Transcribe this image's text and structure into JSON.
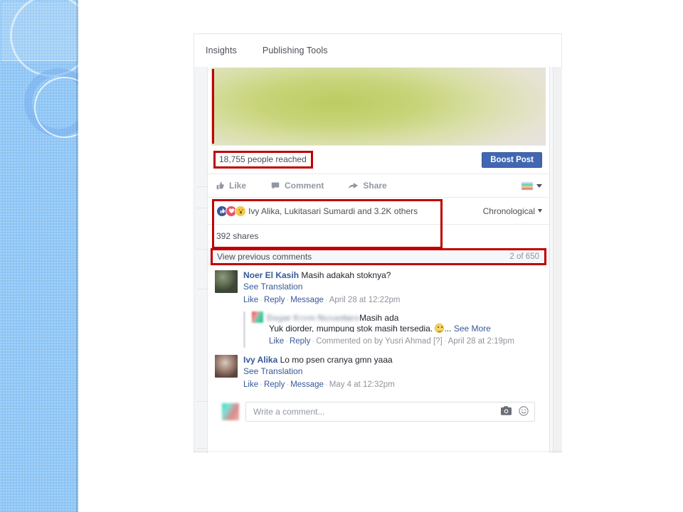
{
  "tabs": [
    {
      "label": "Insights"
    },
    {
      "label": "Publishing Tools"
    }
  ],
  "post": {
    "reach_text": "18,755 people reached",
    "boost_label": "Boost Post",
    "actions": [
      {
        "label": "Like",
        "icon": "thumbs-up-icon"
      },
      {
        "label": "Comment",
        "icon": "comment-bubble-icon"
      },
      {
        "label": "Share",
        "icon": "share-arrow-icon"
      }
    ],
    "audience_icon": "audience-thumbnail-icon",
    "reactions": {
      "icons": [
        "like-reaction-icon",
        "love-reaction-icon",
        "wow-reaction-icon"
      ],
      "summary": "Ivy Alika, Lukitasari Sumardi and 3.2K others"
    },
    "sort_label": "Chronological",
    "shares": "392 shares"
  },
  "comments_header": {
    "view_previous": "View previous comments",
    "count": "2 of 650"
  },
  "comments": [
    {
      "author": "Noer El Kasih",
      "text": "Masih adakah stoknya?",
      "translate": "See Translation",
      "actions": [
        "Like",
        "Reply",
        "Message"
      ],
      "timestamp": "April 28 at 12:22pm"
    },
    {
      "author": "Ivy Alika",
      "text": "Lo mo psen cranya gmn yaaa",
      "translate": "See Translation",
      "actions": [
        "Like",
        "Reply",
        "Message"
      ],
      "timestamp": "May 4 at 12:32pm"
    }
  ],
  "reply": {
    "author_blurred": "Dagar Krem Nusantara",
    "text_line1": "Masih ada",
    "text_line2": "Yuk diorder, mumpung stok masih tersedia.",
    "ellipsis": "...",
    "see_more": "See More",
    "actions": [
      "Like",
      "Reply"
    ],
    "commented_by": "Commented on by Yusri Ahmad",
    "help_marker": "[?]",
    "timestamp": "April 28 at 2:19pm"
  },
  "composer": {
    "placeholder": "Write a comment...",
    "camera_icon": "camera-icon",
    "emoji_icon": "emoji-smiley-icon"
  },
  "colors": {
    "accent_blue": "#4267b2",
    "link_blue": "#365899",
    "highlight_red": "#c00000",
    "muted_gray": "#90949c",
    "slide_blue": "#8ec5f5"
  }
}
